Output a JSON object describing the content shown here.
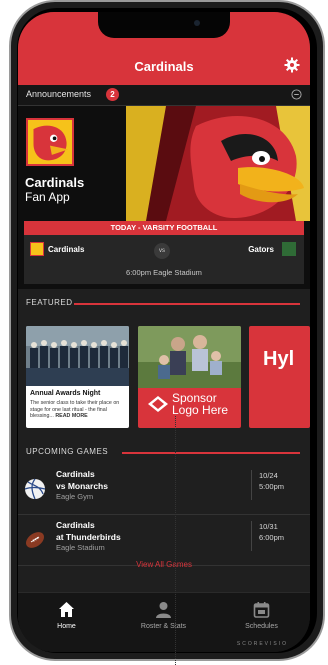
{
  "app": {
    "title": "Cardinals"
  },
  "announcements": {
    "label": "Announcements",
    "count": "2"
  },
  "hero": {
    "app_name": "Cardinals",
    "app_sub": "Fan App"
  },
  "today": {
    "banner": "TODAY - VARSITY FOOTBALL",
    "home": "Cardinals",
    "vs": "vs",
    "away": "Gators",
    "venue": "6:00pm Eagle Stadium"
  },
  "featured": {
    "label": "FEATURED",
    "cards": [
      {
        "title": "Annual Awards Night",
        "desc": "The senior class to take their place on stage for one last ritual - the final blessing...",
        "more": "READ MORE"
      },
      {
        "line1": "Sponsor",
        "line2": "Logo Here"
      },
      {
        "text": "Hyl"
      }
    ]
  },
  "upcoming": {
    "label": "UPCOMING GAMES",
    "games": [
      {
        "team": "Cardinals",
        "opponent": "vs Monarchs",
        "place": "Eagle Gym",
        "date": "10/24",
        "time": "5:00pm",
        "sport_icon": "volleyball-icon"
      },
      {
        "team": "Cardinals",
        "opponent": "at Thunderbirds",
        "place": "Eagle Stadium",
        "date": "10/31",
        "time": "6:00pm",
        "sport_icon": "football-icon"
      }
    ],
    "view_all": "View All Games"
  },
  "tabs": [
    {
      "label": "Home",
      "icon": "home-icon",
      "active": true
    },
    {
      "label": "Roster & Stats",
      "icon": "person-icon",
      "active": false
    },
    {
      "label": "Schedules",
      "icon": "calendar-icon",
      "active": false
    }
  ],
  "brand": "SCOREVISIO",
  "colors": {
    "accent": "#d8343b",
    "background": "#1f1f1f",
    "logo_yellow": "#f6c21a"
  }
}
